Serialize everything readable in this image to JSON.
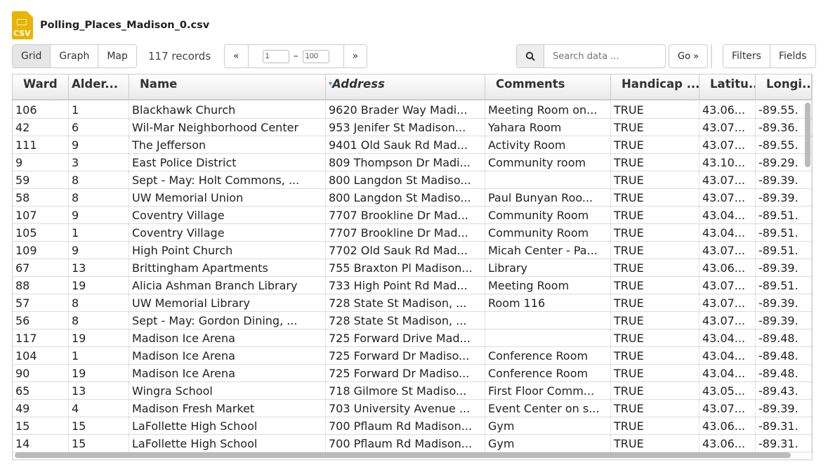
{
  "file": {
    "title": "Polling_Places_Madison_0.csv",
    "icon": "csv-file-icon",
    "icon_label": "CSV"
  },
  "views": [
    "Grid",
    "Graph",
    "Map"
  ],
  "records": "117 records",
  "pager": {
    "prev": "«",
    "from": "1",
    "dash": "–",
    "to": "100",
    "next": "»"
  },
  "search": {
    "placeholder": "Search data ...",
    "go": "Go »"
  },
  "tools": [
    "Filters",
    "Fields"
  ],
  "columns": [
    "Ward",
    "Alder...",
    "Name",
    "Address",
    "Comments",
    "Handicap ...",
    "Latitu...",
    "Longi..."
  ],
  "sorted_column": "Address",
  "rows": [
    [
      "106",
      "1",
      "Blackhawk Church",
      "9620 Brader Way Madi...",
      "Meeting Room on...",
      "TRUE",
      "43.06...",
      "-89.55."
    ],
    [
      "42",
      "6",
      "Wil-Mar Neighborhood Center",
      "953 Jenifer St Madison...",
      "Yahara Room",
      "TRUE",
      "43.07...",
      "-89.36."
    ],
    [
      "111",
      "9",
      "The Jefferson",
      "9401 Old Sauk Rd Mad...",
      "Activity Room",
      "TRUE",
      "43.07...",
      "-89.55."
    ],
    [
      "9",
      "3",
      "East Police District",
      "809 Thompson Dr Madi...",
      "Community room",
      "TRUE",
      "43.10...",
      "-89.29."
    ],
    [
      "59",
      "8",
      "Sept - May: Holt Commons, ...",
      "800 Langdon St Madiso...",
      "",
      "TRUE",
      "43.07...",
      "-89.39."
    ],
    [
      "58",
      "8",
      "UW Memorial Union",
      "800 Langdon St Madiso...",
      "Paul Bunyan Roo...",
      "TRUE",
      "43.07...",
      "-89.39."
    ],
    [
      "107",
      "9",
      "Coventry Village",
      "7707 Brookline Dr Mad...",
      "Community Room",
      "TRUE",
      "43.04...",
      "-89.51."
    ],
    [
      "105",
      "1",
      "Coventry Village",
      "7707 Brookline Dr Mad...",
      "Community Room",
      "TRUE",
      "43.04...",
      "-89.51."
    ],
    [
      "109",
      "9",
      "High Point Church",
      "7702 Old Sauk Rd Mad...",
      "Micah Center - Pa...",
      "TRUE",
      "43.07...",
      "-89.51."
    ],
    [
      "67",
      "13",
      "Brittingham Apartments",
      "755 Braxton Pl Madison...",
      "Library",
      "TRUE",
      "43.06...",
      "-89.39."
    ],
    [
      "88",
      "19",
      "Alicia Ashman Branch Library",
      "733 High Point Rd Mad...",
      "Meeting Room",
      "TRUE",
      "43.07...",
      "-89.51."
    ],
    [
      "57",
      "8",
      "UW Memorial Library",
      "728 State St Madison, ...",
      "Room 116",
      "TRUE",
      "43.07...",
      "-89.39."
    ],
    [
      "56",
      "8",
      "Sept - May: Gordon Dining, ...",
      "728 State St Madison, ...",
      "",
      "TRUE",
      "43.07...",
      "-89.39."
    ],
    [
      "117",
      "19",
      "Madison Ice Arena",
      "725 Forward Drive Mad...",
      "",
      "TRUE",
      "43.04...",
      "-89.48."
    ],
    [
      "104",
      "1",
      "Madison Ice Arena",
      "725 Forward Dr Madiso...",
      "Conference Room",
      "TRUE",
      "43.04...",
      "-89.48."
    ],
    [
      "90",
      "19",
      "Madison Ice Arena",
      "725 Forward Dr Madiso...",
      "Conference Room",
      "TRUE",
      "43.04...",
      "-89.48."
    ],
    [
      "65",
      "13",
      "Wingra School",
      "718 Gilmore St Madiso...",
      "First Floor Comm...",
      "TRUE",
      "43.05...",
      "-89.43."
    ],
    [
      "49",
      "4",
      "Madison Fresh Market",
      "703 University Avenue ...",
      "Event Center on s...",
      "TRUE",
      "43.07...",
      "-89.39."
    ],
    [
      "15",
      "15",
      "LaFollette High School",
      "700 Pflaum Rd Madison...",
      "Gym",
      "TRUE",
      "43.06...",
      "-89.31."
    ],
    [
      "14",
      "15",
      "LaFollette High School",
      "700 Pflaum Rd Madison...",
      "Gym",
      "TRUE",
      "43.06...",
      "-89.31."
    ]
  ]
}
